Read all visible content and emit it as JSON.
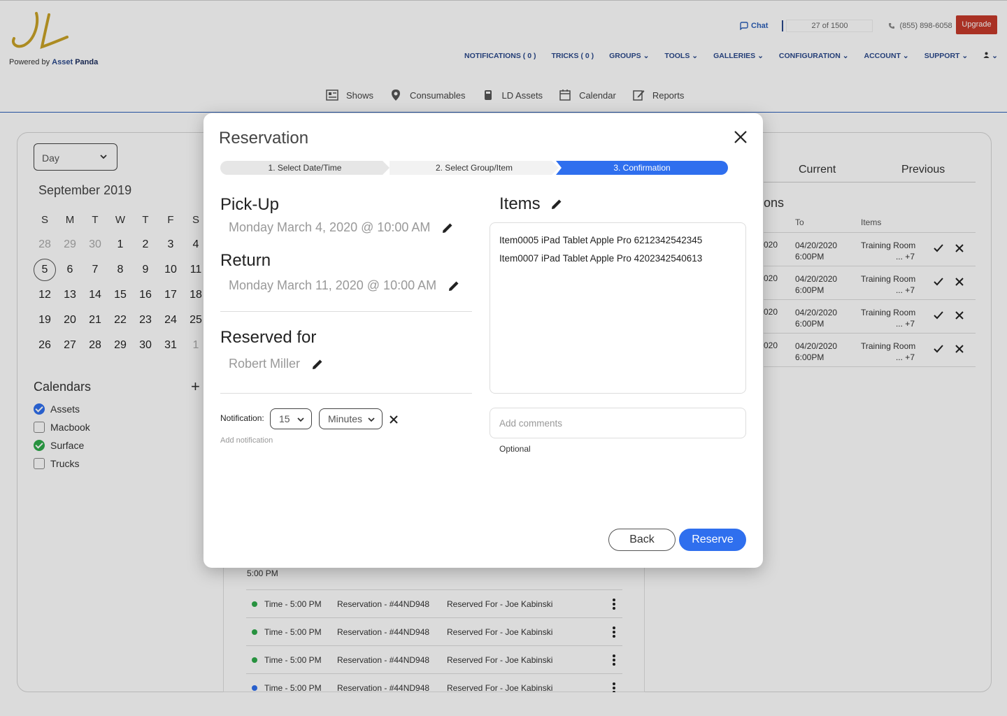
{
  "brand": {
    "powered_prefix": "Powered by",
    "powered_asset": "Asset",
    "powered_panda": "Panda"
  },
  "utility": {
    "chat": "Chat",
    "usage": "27 of 1500",
    "phone": "(855) 898-6058",
    "upgrade": "Upgrade"
  },
  "main_nav": [
    "NOTIFICATIONS ( 0 )",
    "TRICKS ( 0 )",
    "GROUPS",
    "TOOLS",
    "GALLERIES",
    "CONFIGURATION",
    "ACCOUNT",
    "SUPPORT"
  ],
  "sub_nav": [
    {
      "label": "Shows",
      "icon": "shows-icon"
    },
    {
      "label": "Consumables",
      "icon": "map-pin-icon"
    },
    {
      "label": "LD Assets",
      "icon": "assets-icon"
    },
    {
      "label": "Calendar",
      "icon": "calendar-icon"
    },
    {
      "label": "Reports",
      "icon": "reports-icon"
    }
  ],
  "view_select": {
    "value": "Day"
  },
  "calendar": {
    "month": "September",
    "year": "2019",
    "weekdays": [
      "S",
      "M",
      "T",
      "W",
      "T",
      "F",
      "S"
    ],
    "weeks": [
      [
        "28",
        "29",
        "30",
        "1",
        "2",
        "3",
        "4"
      ],
      [
        "5",
        "6",
        "7",
        "8",
        "9",
        "10",
        "11"
      ],
      [
        "12",
        "13",
        "14",
        "15",
        "16",
        "17",
        "18"
      ],
      [
        "19",
        "20",
        "21",
        "22",
        "23",
        "24",
        "25"
      ],
      [
        "26",
        "27",
        "28",
        "29",
        "30",
        "31",
        "1"
      ]
    ]
  },
  "calendars": {
    "title": "Calendars",
    "items": [
      {
        "label": "Assets",
        "checked": true,
        "color": "#2f6fee"
      },
      {
        "label": "Macbook",
        "checked": false,
        "color": ""
      },
      {
        "label": "Surface",
        "checked": true,
        "color": "#2eaa4a"
      },
      {
        "label": "Trucks",
        "checked": false,
        "color": ""
      }
    ]
  },
  "reservations_panel": {
    "tabs": [
      "Current",
      "Previous"
    ],
    "heading_fragment": "ons",
    "columns": {
      "to": "To",
      "items": "Items"
    },
    "rows": [
      {
        "from_fragment": "020",
        "to_date": "04/20/2020",
        "to_time": "6:00PM",
        "items": "Training Room",
        "more": "... +7"
      },
      {
        "from_fragment": "020",
        "to_date": "04/20/2020",
        "to_time": "6:00PM",
        "items": "Training Room",
        "more": "... +7"
      },
      {
        "from_fragment": "020",
        "to_date": "04/20/2020",
        "to_time": "6:00PM",
        "items": "Training Room",
        "more": "... +7"
      },
      {
        "from_fragment": "020",
        "to_date": "04/20/2020",
        "to_time": "6:00PM",
        "items": "Training Room",
        "more": "... +7"
      }
    ]
  },
  "day_list": {
    "time_header": "5:00 PM",
    "rows": [
      {
        "time": "Time - 5:00 PM",
        "reservation": "Reservation - #44ND948",
        "reserved_for": "Reserved For - Joe Kabinski",
        "dot_color": "#2eaa4a"
      },
      {
        "time": "Time - 5:00 PM",
        "reservation": "Reservation - #44ND948",
        "reserved_for": "Reserved For - Joe Kabinski",
        "dot_color": "#2eaa4a"
      },
      {
        "time": "Time - 5:00 PM",
        "reservation": "Reservation - #44ND948",
        "reserved_for": "Reserved For - Joe Kabinski",
        "dot_color": "#2eaa4a"
      },
      {
        "time": "Time - 5:00 PM",
        "reservation": "Reservation - #44ND948",
        "reserved_for": "Reserved For - Joe Kabinski",
        "dot_color": "#2f6fee"
      }
    ]
  },
  "modal": {
    "title": "Reservation",
    "steps": [
      "1. Select Date/Time",
      "2. Select Group/Item",
      "3. Confirmation"
    ],
    "active_step": 3,
    "pickup": {
      "label": "Pick-Up",
      "value": "Monday March 4, 2020 @ 10:00 AM"
    },
    "return": {
      "label": "Return",
      "value": "Monday March 11, 2020 @ 10:00 AM"
    },
    "reserved_for": {
      "label": "Reserved for",
      "value": "Robert Miller"
    },
    "notification": {
      "label": "Notification:",
      "amount": "15",
      "unit": "Minutes",
      "add_label": "Add notification"
    },
    "items": {
      "label": "Items",
      "list": [
        "Item0005 iPad Tablet Apple Pro 6212342542345",
        "Item0007 iPad Tablet Apple Pro 4202342540613"
      ]
    },
    "comments": {
      "placeholder": "Add comments",
      "hint": "Optional"
    },
    "buttons": {
      "back": "Back",
      "reserve": "Reserve"
    }
  },
  "colors": {
    "primary": "#2f6fee",
    "brand_navy": "#2c4a8c",
    "upgrade_red": "#c53a2b",
    "check_green": "#2eaa4a"
  }
}
